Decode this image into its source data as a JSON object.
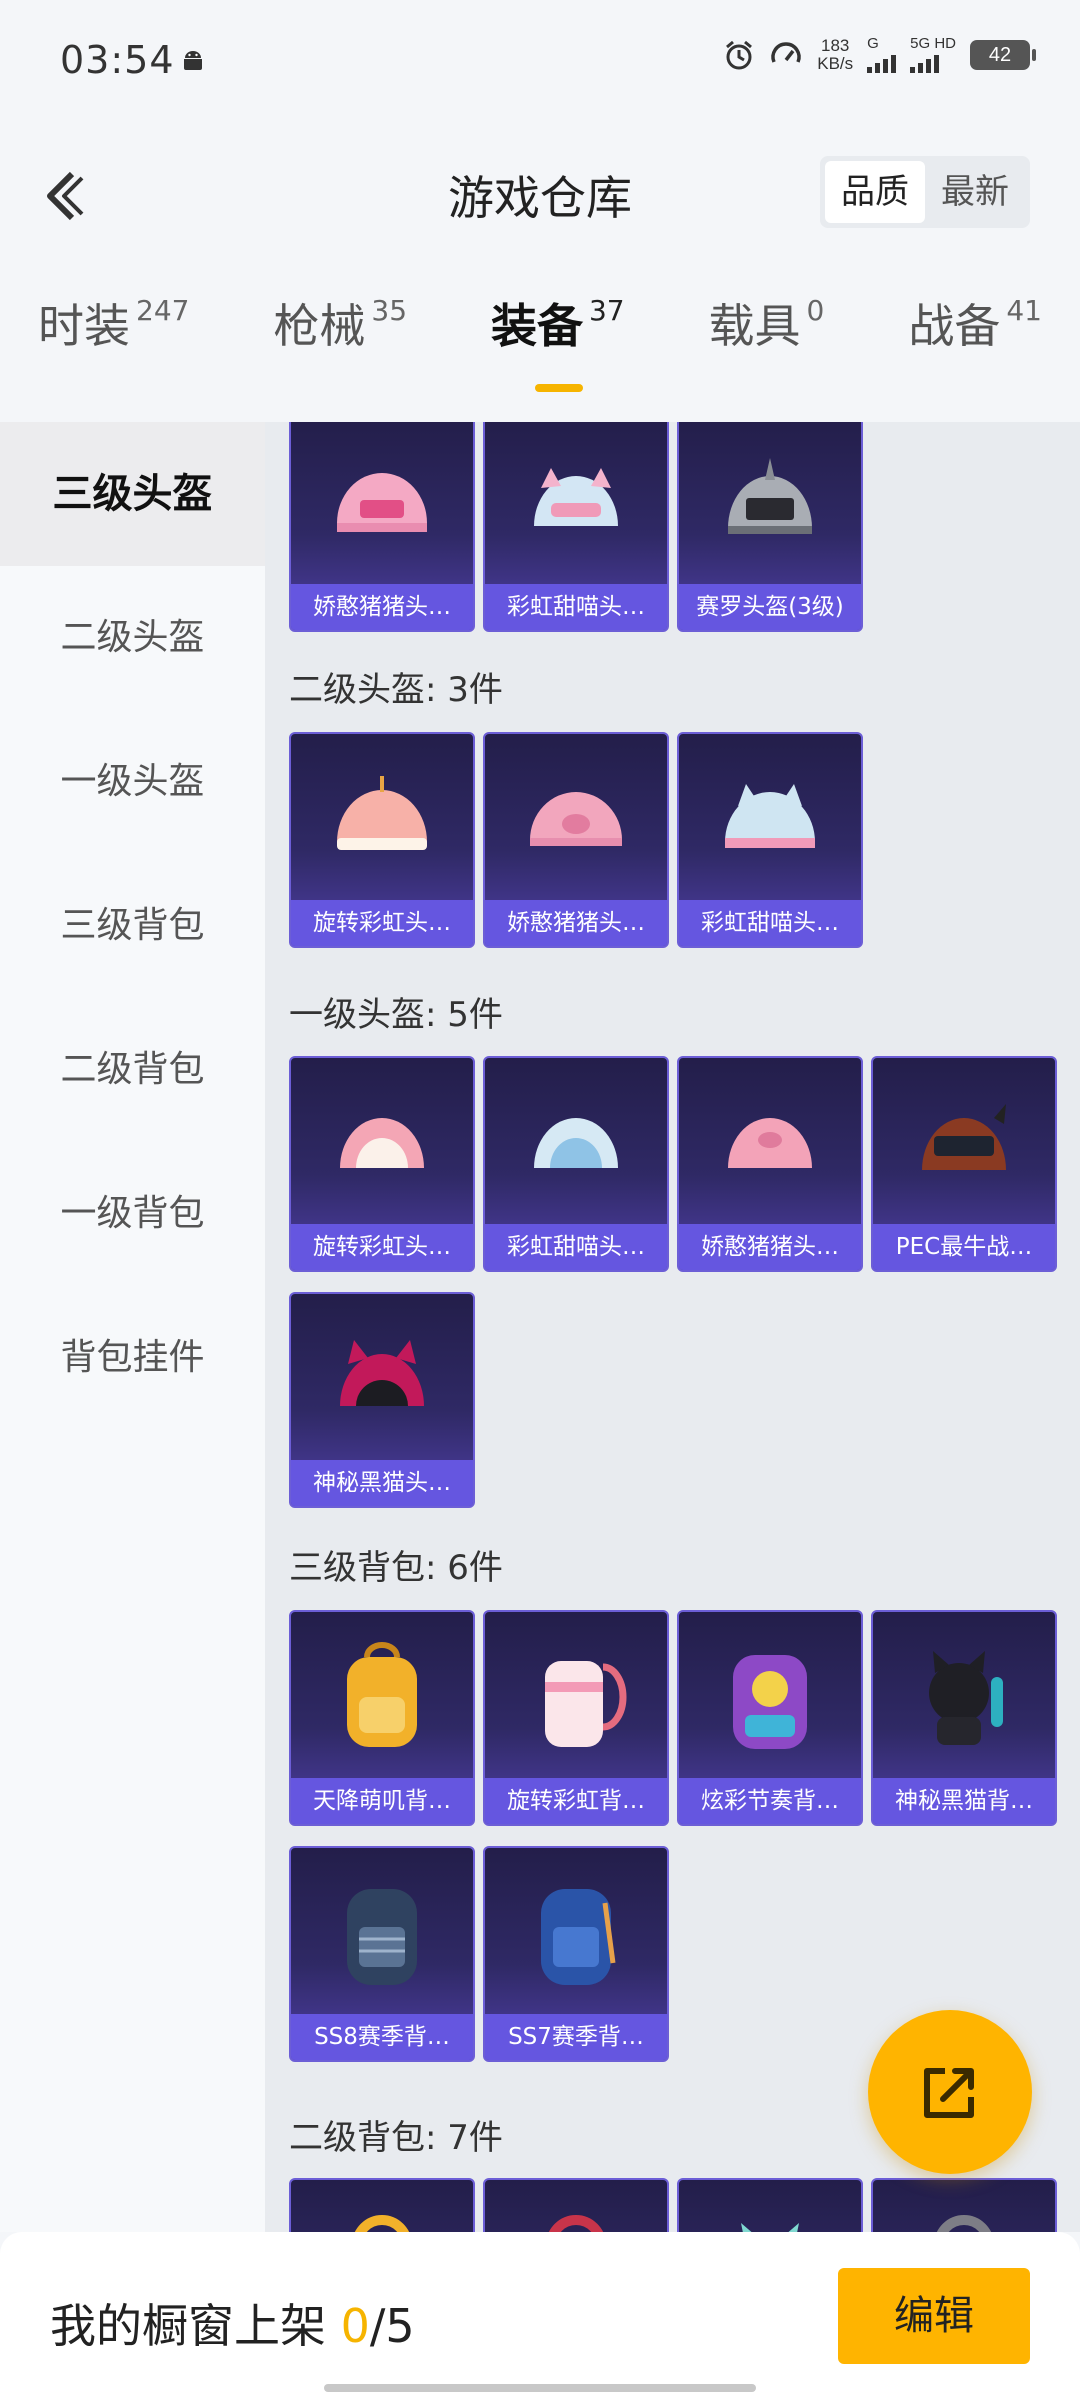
{
  "status_bar": {
    "time": "03:54",
    "speed_value": "183",
    "speed_unit": "KB/s",
    "net1": "G",
    "net2": "5G HD",
    "battery": "42"
  },
  "header": {
    "title": "游戏仓库",
    "sort_options": [
      "品质",
      "最新"
    ]
  },
  "tabs": [
    {
      "label": "时装",
      "count": "247"
    },
    {
      "label": "枪械",
      "count": "35"
    },
    {
      "label": "装备",
      "count": "37",
      "active": true
    },
    {
      "label": "载具",
      "count": "0"
    },
    {
      "label": "战备",
      "count": "41"
    }
  ],
  "sidebar": [
    "三级头盔",
    "二级头盔",
    "一级头盔",
    "三级背包",
    "二级背包",
    "一级背包",
    "背包挂件"
  ],
  "sections": {
    "lvl3_helmet": [
      "娇憨猪猪头…",
      "彩虹甜喵头…",
      "赛罗头盔(3级)"
    ],
    "lvl2_helmet": {
      "title": "二级头盔: 3件",
      "items": [
        "旋转彩虹头…",
        "娇憨猪猪头…",
        "彩虹甜喵头…"
      ]
    },
    "lvl1_helmet": {
      "title": "一级头盔: 5件",
      "items": [
        "旋转彩虹头…",
        "彩虹甜喵头…",
        "娇憨猪猪头…",
        "PEC最牛战…",
        "神秘黑猫头…"
      ]
    },
    "lvl3_backpack": {
      "title": "三级背包: 6件",
      "items": [
        "天降萌叽背…",
        "旋转彩虹背…",
        "炫彩节奏背…",
        "神秘黑猫背…",
        "SS8赛季背…",
        "SS7赛季背…"
      ]
    },
    "lvl2_backpack": {
      "title": "二级背包: 7件"
    }
  },
  "bottom": {
    "label": "我的橱窗上架",
    "current": "0",
    "total": "/5",
    "edit_label": "编辑"
  },
  "colors": {
    "accent": "#ffb400",
    "card_label": "#6556e0",
    "card_bg": "#2f2965"
  }
}
